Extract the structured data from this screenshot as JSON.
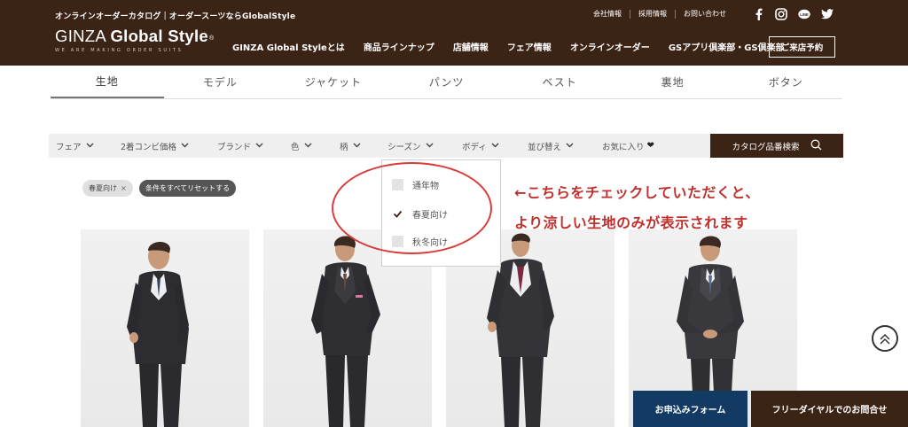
{
  "header": {
    "tagline": "オンラインオーダーカタログ｜オーダースーツならGlobalStyle",
    "logo_main_1": "GINZA ",
    "logo_main_2": "Global Style",
    "logo_reg": "®",
    "logo_sub": "WE ARE MAKING ORDER SUITS",
    "util_links": [
      "会社情報",
      "採用情報",
      "お問い合わせ"
    ],
    "social_icons": [
      "facebook-icon",
      "instagram-icon",
      "line-icon",
      "twitter-icon"
    ],
    "nav": [
      "GINZA Global Styleとは",
      "商品ラインナップ",
      "店舗情報",
      "フェア情報",
      "オンラインオーダー",
      "GSアプリ倶楽部・GS倶楽部"
    ],
    "visit_button": "ご来店予約",
    "colors": {
      "brand": "#3b2316",
      "navy": "#133a63",
      "annotation": "#c0302d"
    }
  },
  "tabs": [
    "生地",
    "モデル",
    "ジャケット",
    "パンツ",
    "ベスト",
    "裏地",
    "ボタン"
  ],
  "active_tab": "生地",
  "filters": {
    "fair": "フェア",
    "combo_price": "2着コンビ価格",
    "brand": "ブランド",
    "color": "色",
    "pattern": "柄",
    "season": "シーズン",
    "body": "ボディ",
    "sort": "並び替え",
    "favorites": "お気に入り",
    "catalog_search": "カタログ品番検索"
  },
  "season_dropdown": {
    "options": [
      {
        "label": "通年物",
        "checked": false
      },
      {
        "label": "春夏向け",
        "checked": true
      },
      {
        "label": "秋冬向け",
        "checked": false
      }
    ]
  },
  "chips": {
    "active_filter": "春夏向け",
    "reset": "条件をすべてリセットする"
  },
  "annotation": {
    "line1": "←こちらをチェックしていただくと、",
    "line2": "より涼しい生地のみが表示されます"
  },
  "products": [
    "product-1",
    "product-2",
    "product-3",
    "product-4"
  ],
  "floating": {
    "apply_form": "お申込みフォーム",
    "free_dial": "フリーダイヤルでのお問合せ"
  }
}
